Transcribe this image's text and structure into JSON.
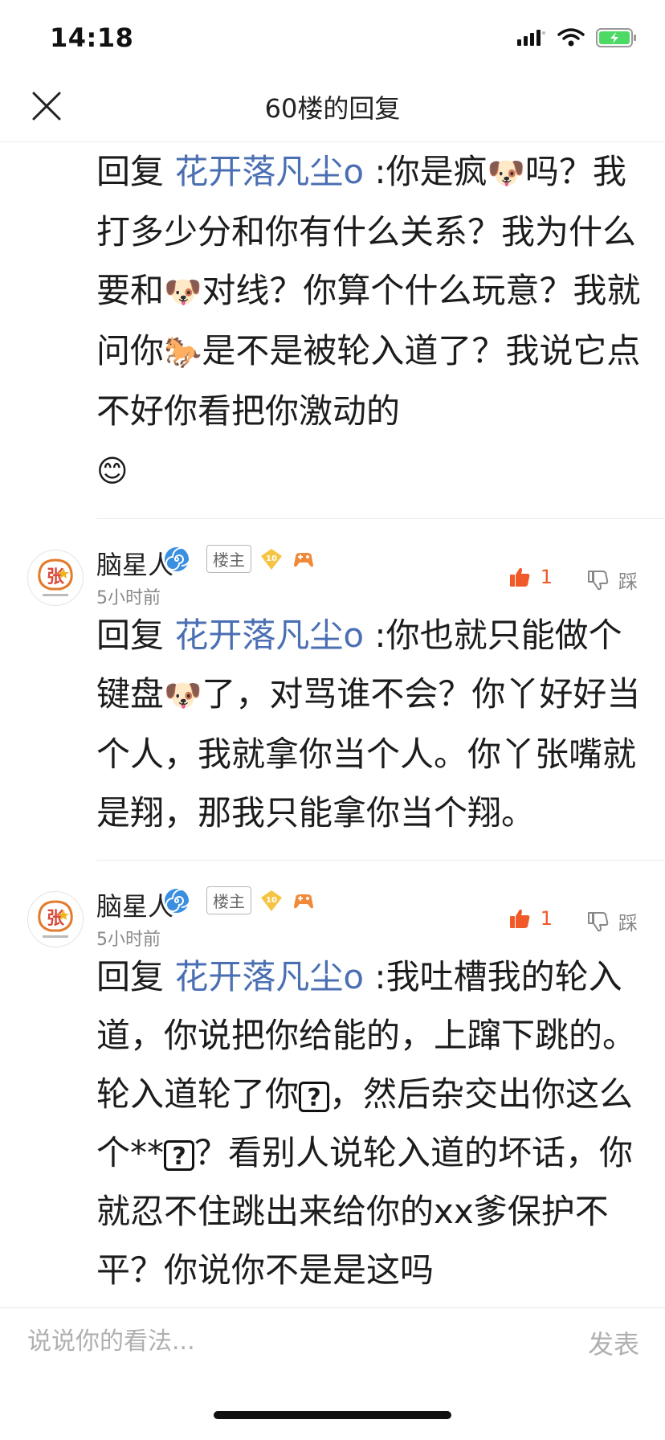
{
  "status": {
    "time": "14:18"
  },
  "nav": {
    "title": "60楼的回复"
  },
  "replies": [
    {
      "prefix": "回复 ",
      "mention": "花开落凡尘o",
      "segments": [
        " :你是疯",
        "🐶",
        "吗？我打多少分和你有什么关系？我为什么要和",
        "🐶",
        "对线？你算个什么玩意？我就问你",
        "🐎",
        "是不是被轮入道了？我说它点不好你看把你激动的",
        "😊"
      ]
    }
  ],
  "comments": [
    {
      "username": "脑星人",
      "owner_badge": "楼主",
      "level": "10",
      "timestamp": "5小时前",
      "like_count": "1",
      "dislike_label": "踩",
      "prefix": "回复 ",
      "mention": "花开落凡尘o",
      "segments": [
        " :你也就只能做个键盘",
        "🐶",
        "了，对骂谁不会？你丫好好当个人，我就拿你当个人。你丫张嘴就是翔，那我只能拿你当个翔。"
      ]
    },
    {
      "username": "脑星人",
      "owner_badge": "楼主",
      "level": "10",
      "timestamp": "5小时前",
      "like_count": "1",
      "dislike_label": "踩",
      "prefix": "回复 ",
      "mention": "花开落凡尘o",
      "segments": [
        " :我吐槽我的轮入道，你说把你给能的，上蹿下跳的。轮入道轮了你",
        "?",
        "，然后杂交出你这么个**",
        "?",
        "？看别人说轮入道的坏话，你就忍不住跳出来给你的xx爹保护不平？你说你不是是这吗"
      ]
    }
  ],
  "input": {
    "placeholder": "说说你的看法...",
    "send_label": "发表"
  },
  "colors": {
    "mention": "#4a6fb3",
    "like": "#f05a28",
    "muted": "#8a8a8a"
  }
}
